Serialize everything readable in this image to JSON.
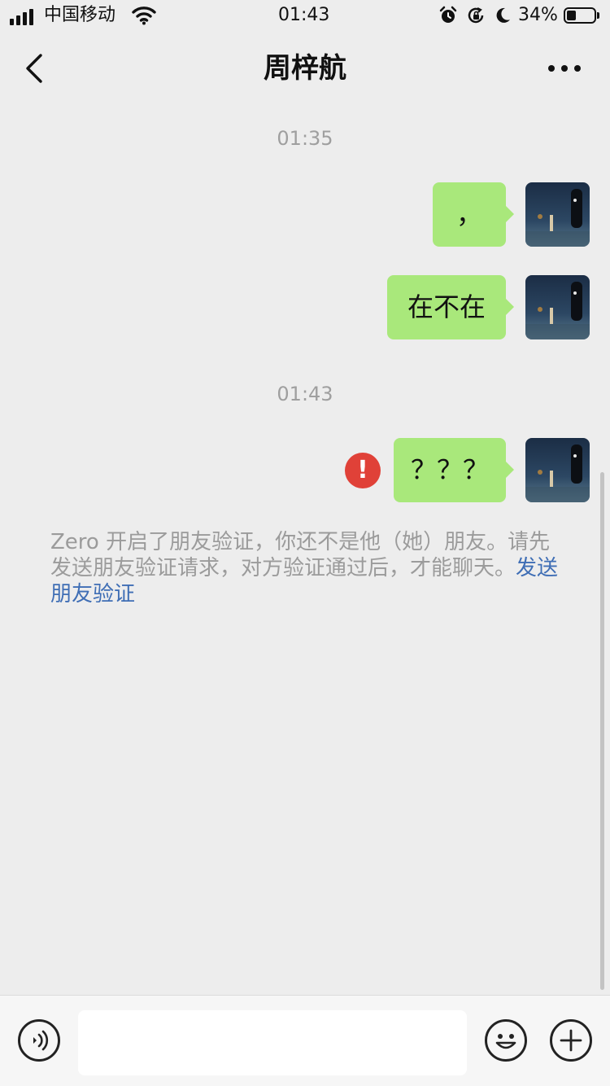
{
  "status_bar": {
    "carrier": "中国移动",
    "time": "01:43",
    "battery_percent": "34%",
    "battery_level": 0.34,
    "icons": [
      "signal-icon",
      "wifi-icon",
      "alarm-icon",
      "rotation-lock-icon",
      "moon-icon",
      "battery-icon"
    ]
  },
  "header": {
    "title": "周梓航",
    "back_icon": "chevron-left-icon",
    "more_icon": "more-dots-icon"
  },
  "chat": {
    "time_dividers": [
      "01:35",
      "01:43"
    ],
    "messages": [
      {
        "from": "me",
        "text": "，"
      },
      {
        "from": "me",
        "text": "在不在"
      },
      {
        "from": "me",
        "text": "？？？",
        "failed": true
      }
    ],
    "error_symbol": "!",
    "system_notice": {
      "text": "Zero 开启了朋友验证，你还不是他（她）朋友。请先发送朋友验证请求，对方验证通过后，才能聊天。",
      "link": "发送朋友验证"
    }
  },
  "input_bar": {
    "voice_icon": "voice-icon",
    "message_value": "",
    "emoji_icon": "emoji-icon",
    "plus_icon": "plus-icon"
  },
  "colors": {
    "background": "#ededed",
    "my_bubble": "#a9e87b",
    "error_red": "#e04138",
    "link_blue": "#3f6eb5",
    "muted_text": "#9b9b9b"
  }
}
